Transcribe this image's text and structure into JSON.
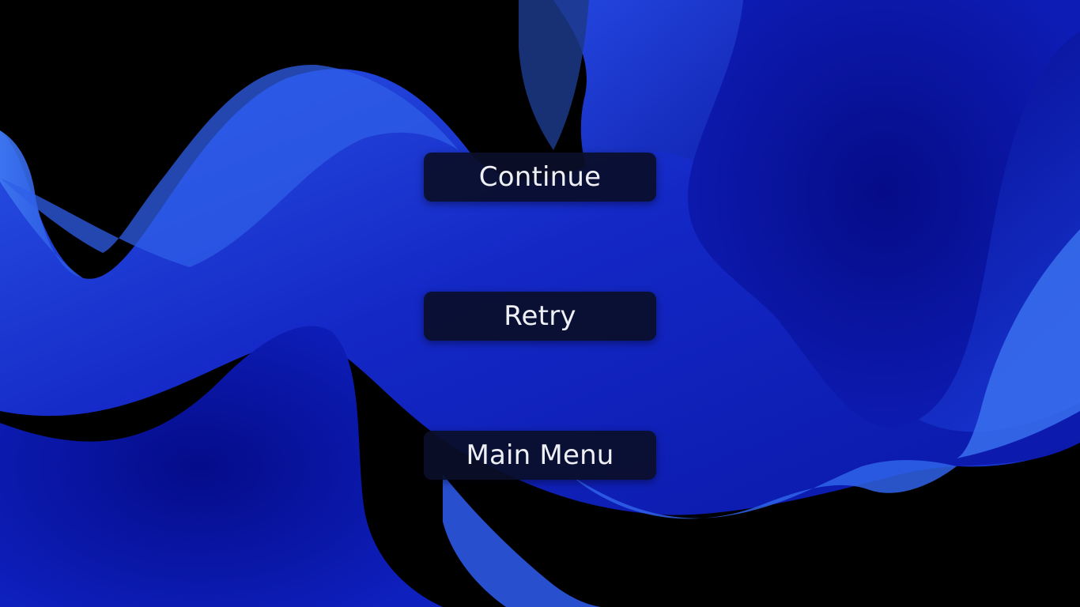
{
  "pause_menu": {
    "continue_label": "Continue",
    "retry_label": "Retry",
    "main_menu_label": "Main Menu"
  },
  "background": {
    "base_color": "#000000",
    "deep_blue": "#07108f",
    "mid_blue": "#1424c8",
    "bright_blue": "#2f5fe8",
    "button_bg": "#0a0e28",
    "button_text": "#eef0f6"
  }
}
